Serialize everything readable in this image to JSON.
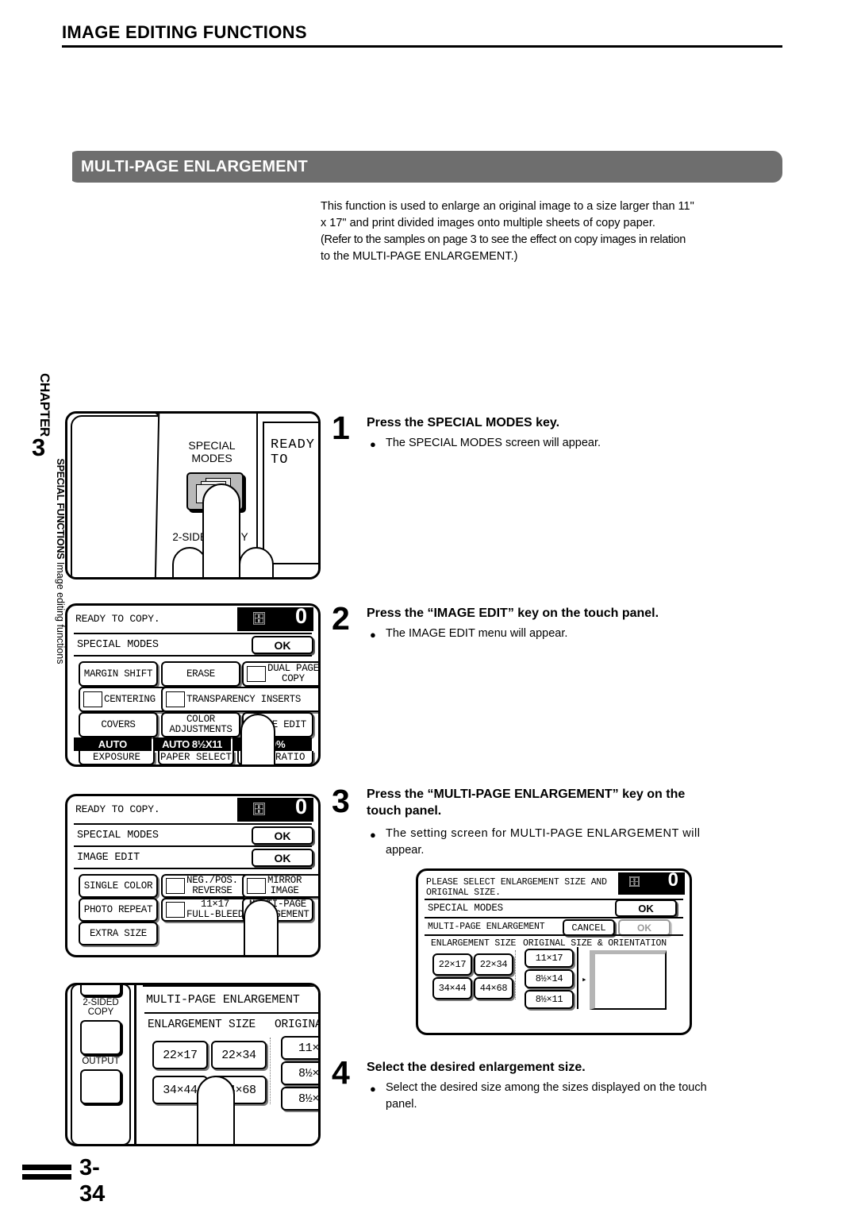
{
  "header": {
    "title": "IMAGE EDITING FUNCTIONS"
  },
  "banner": {
    "title": "MULTI-PAGE ENLARGEMENT",
    "color": "#6e6e6e"
  },
  "intro": {
    "line1": "This function is used to enlarge an original image to a size larger than 11\"",
    "line2": "x 17\" and print divided images onto multiple sheets of copy paper.",
    "line3": "(Refer to the samples on page 3 to see the effect on copy images in relation",
    "line4": "to the MULTI-PAGE ENLARGEMENT.)"
  },
  "sidebar": {
    "chapter_word": "CHAPTER",
    "chapter_number": "3",
    "section_bold": "SPECIAL FUNCTIONS",
    "section_plain": "Image editing functions"
  },
  "steps": [
    {
      "number": "1",
      "heading": "Press the SPECIAL MODES key.",
      "bullet": "The SPECIAL MODES screen will appear."
    },
    {
      "number": "2",
      "heading": "Press the “IMAGE EDIT” key on the touch panel.",
      "bullet": "The IMAGE EDIT menu will appear."
    },
    {
      "number": "3",
      "heading_line1": "Press the “MULTI-PAGE ENLARGEMENT” key on the",
      "heading_line2": "touch panel.",
      "bullet_line1": "The setting screen for MULTI-PAGE ENLARGEMENT will",
      "bullet_line2": "appear."
    },
    {
      "number": "4",
      "heading": "Select the desired enlargement size.",
      "bullet_line1": "Select the desired size among the sizes displayed on the touch",
      "bullet_line2": "panel."
    }
  ],
  "illustration1": {
    "label_special_modes": "SPECIAL\nMODES",
    "label_ready": "READY TO",
    "label_2sided": "2-SIDED\nCOPY",
    "key_icon": "stacked-pages-icon"
  },
  "illustration2": {
    "status_message": "READY TO COPY.",
    "copy_count": "0",
    "paper_icon": "paper-feed-icon",
    "section_label": "SPECIAL MODES",
    "ok_label": "OK",
    "keys": [
      "MARGIN SHIFT",
      "ERASE",
      "DUAL PAGE\nCOPY",
      "CENTERING",
      "TRANSPARENCY INSERTS",
      "COVERS",
      "COLOR\nADJUSTMENTS",
      "IMAGE EDIT"
    ],
    "bottom": [
      {
        "value": "AUTO",
        "label": "EXPOSURE"
      },
      {
        "value": "AUTO      8½X11",
        "label": "PAPER SELECT"
      },
      {
        "value": "100%",
        "label": "COPY RATIO"
      }
    ]
  },
  "illustration3": {
    "status_message": "READY TO COPY.",
    "copy_count": "0",
    "section_label": "SPECIAL MODES",
    "ok_label": "OK",
    "submenu_label": "IMAGE EDIT",
    "submenu_ok_label": "OK",
    "keys": [
      "SINGLE COLOR",
      "NEG./POS.\nREVERSE",
      "MIRROR\nIMAGE",
      "PHOTO REPEAT",
      "11×17\nFULL-BLEED",
      "MULTI-PAGE\nENLARGEMENT",
      "EXTRA SIZE"
    ]
  },
  "illustration4": {
    "panel_2sided": "2-SIDED\nCOPY",
    "panel_output": "OUTPUT",
    "screen_title": "MULTI-PAGE ENLARGEMENT",
    "col1_header": "ENLARGEMENT SIZE",
    "col2_header": "ORIGINA",
    "enlargement_sizes": [
      "22×17",
      "22×34",
      "34×44",
      "44×68"
    ],
    "original_sizes": [
      "11×",
      "8½×",
      "8½×"
    ]
  },
  "illustration5": {
    "status_message": "PLEASE SELECT ENLARGEMENT SIZE AND\nORIGINAL SIZE.",
    "copy_count": "0",
    "section_label": "SPECIAL MODES",
    "ok_label": "OK",
    "submenu_label": "MULTI-PAGE ENLARGEMENT",
    "cancel_label": "CANCEL",
    "submenu_ok_label": "OK",
    "col1_header": "ENLARGEMENT SIZE",
    "col2_header": "ORIGINAL SIZE & ORIENTATION",
    "enlargement_sizes": [
      "22×17",
      "22×34",
      "34×44",
      "44×68"
    ],
    "original_sizes": [
      "11×17",
      "8½×14",
      "8½×11"
    ]
  },
  "footer": {
    "page_number": "3-34"
  }
}
